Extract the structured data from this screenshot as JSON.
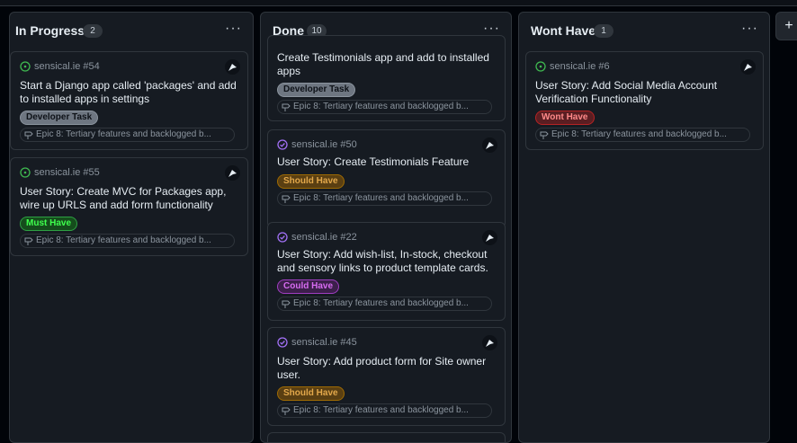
{
  "columns": [
    {
      "title": "In Progress",
      "count": "2",
      "cards": [
        {
          "ref": "sensical.ie #54",
          "status": "open",
          "title": "Start a Django app called 'packages' and add to installed apps in settings",
          "label": "Developer Task",
          "label_kind": "dev",
          "epic": "Epic 8: Tertiary features and backlogged b..."
        },
        {
          "ref": "sensical.ie #55",
          "status": "open",
          "title": "User Story: Create MVC for Packages app, wire up URLS and add form functionality",
          "label": "Must Have",
          "label_kind": "must",
          "epic": "Epic 8: Tertiary features and backlogged b..."
        }
      ]
    },
    {
      "title": "Done",
      "count": "10",
      "cards": [
        {
          "ref": "",
          "status": "",
          "title": "Create Testimonials app and add to installed apps",
          "label": "Developer Task",
          "label_kind": "dev",
          "epic": "Epic 8: Tertiary features and backlogged b..."
        },
        {
          "ref": "sensical.ie #50",
          "status": "closed",
          "title": "User Story: Create Testimonials Feature",
          "label": "Should Have",
          "label_kind": "should",
          "epic": "Epic 8: Tertiary features and backlogged b..."
        },
        {
          "ref": "sensical.ie #22",
          "status": "closed",
          "title": "User Story: Add wish-list, In-stock, checkout and sensory links to product template cards.",
          "label": "Could Have",
          "label_kind": "could",
          "epic": "Epic 8: Tertiary features and backlogged b..."
        },
        {
          "ref": "sensical.ie #45",
          "status": "closed",
          "title": "User Story: Add product form for Site owner user.",
          "label": "Should Have",
          "label_kind": "should",
          "epic": "Epic 8: Tertiary features and backlogged b..."
        }
      ]
    },
    {
      "title": "Wont Have",
      "count": "1",
      "cards": [
        {
          "ref": "sensical.ie #6",
          "status": "open",
          "title": "User Story: Add Social Media Account Verification Functionality",
          "label": "Wont Have",
          "label_kind": "wont",
          "epic": "Epic 8: Tertiary features and backlogged b..."
        }
      ]
    }
  ],
  "menu_glyph": "···",
  "add_column_glyph": "+",
  "colors": {
    "open_icon": "#3fb950",
    "closed_icon": "#a371f7"
  },
  "icons": {
    "open": "issue-opened-icon",
    "closed": "issue-closed-icon",
    "epic": "milestone-icon",
    "menu": "kebab-horizontal-icon",
    "add": "plus-icon"
  }
}
